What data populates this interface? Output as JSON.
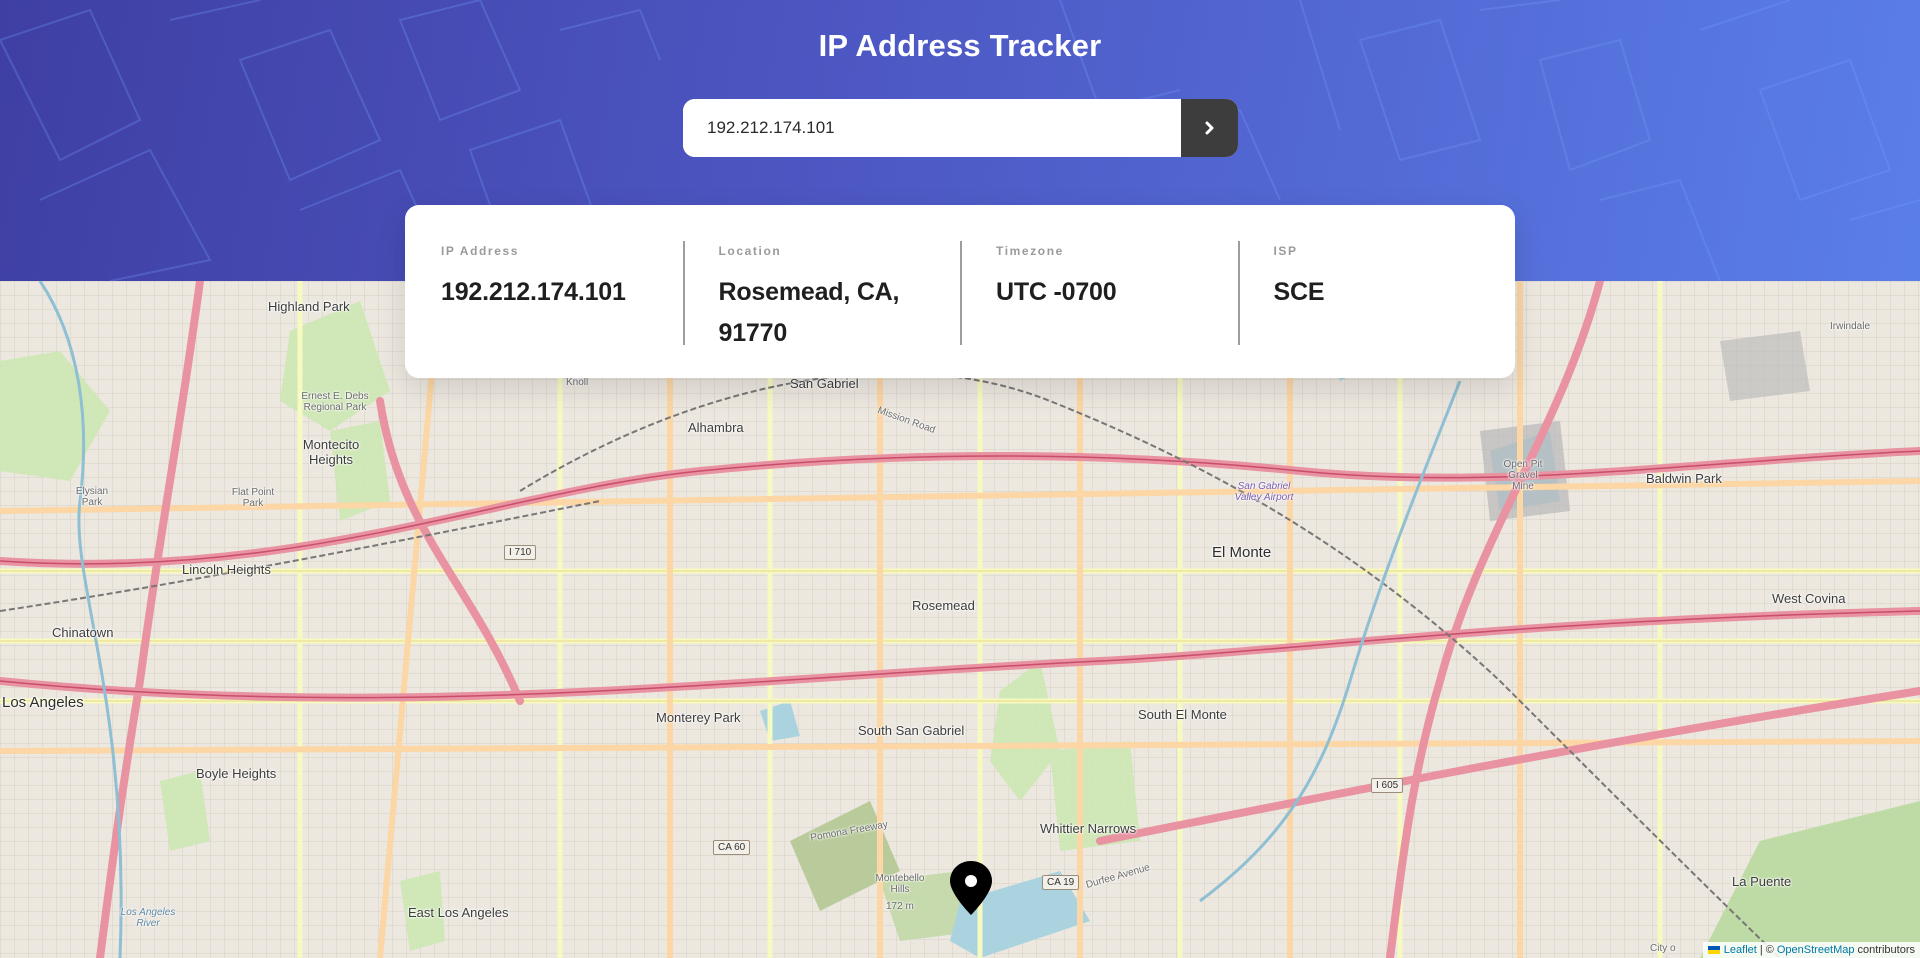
{
  "app": {
    "title": "IP Address Tracker"
  },
  "search": {
    "value": "192.212.174.101",
    "submit_icon": "chevron-right-icon"
  },
  "info": [
    {
      "label": "IP Address",
      "value": "192.212.174.101"
    },
    {
      "label": "Location",
      "value": "Rosemead, CA, 91770"
    },
    {
      "label": "Timezone",
      "value": "UTC -0700"
    },
    {
      "label": "ISP",
      "value": "SCE"
    }
  ],
  "map": {
    "marker_icon": "location-pin-icon",
    "places": {
      "highland_park": "Highland Park",
      "ernest_debs": "Ernest E. Debs Regional Park",
      "montecito_heights": "Montecito Heights",
      "elysian_park": "Elysian Park",
      "flat_point_park": "Flat Point Park",
      "lincoln_heights": "Lincoln Heights",
      "chinatown": "Chinatown",
      "los_angeles": "Los Angeles",
      "boyle_heights": "Boyle Heights",
      "east_los_angeles": "East Los Angeles",
      "los_angeles_river": "Los Angeles River",
      "alhambra": "Alhambra",
      "san_gabriel": "San Gabriel",
      "knoll": "Knoll",
      "mission_road": "Mission Road",
      "monterey_park": "Monterey Park",
      "south_san_gabriel": "South San Gabriel",
      "rosemead": "Rosemead",
      "el_monte": "El Monte",
      "south_el_monte": "South El Monte",
      "whittier_narrows": "Whittier Narrows",
      "montebello_hills": "Montebello Hills",
      "montebello_elev": "172 m",
      "san_gabriel_valley_airport": "San Gabriel Valley Airport",
      "open_pit_mine": "Open Pit Gravel Mine",
      "baldwin_park": "Baldwin Park",
      "irwindale": "Irwindale",
      "west_covina": "West Covina",
      "la_puente": "La Puente",
      "pomona_freeway": "Pomona Freeway",
      "durfee_avenue": "Durfee Avenue",
      "city_of": "City o"
    },
    "shields": {
      "i710": "I 710",
      "ca60": "CA 60",
      "ca19": "CA 19",
      "i605": "I 605"
    },
    "attribution": {
      "leaflet": "Leaflet",
      "separator": "| ©",
      "osm": "OpenStreetMap",
      "contributors": "contributors"
    }
  }
}
